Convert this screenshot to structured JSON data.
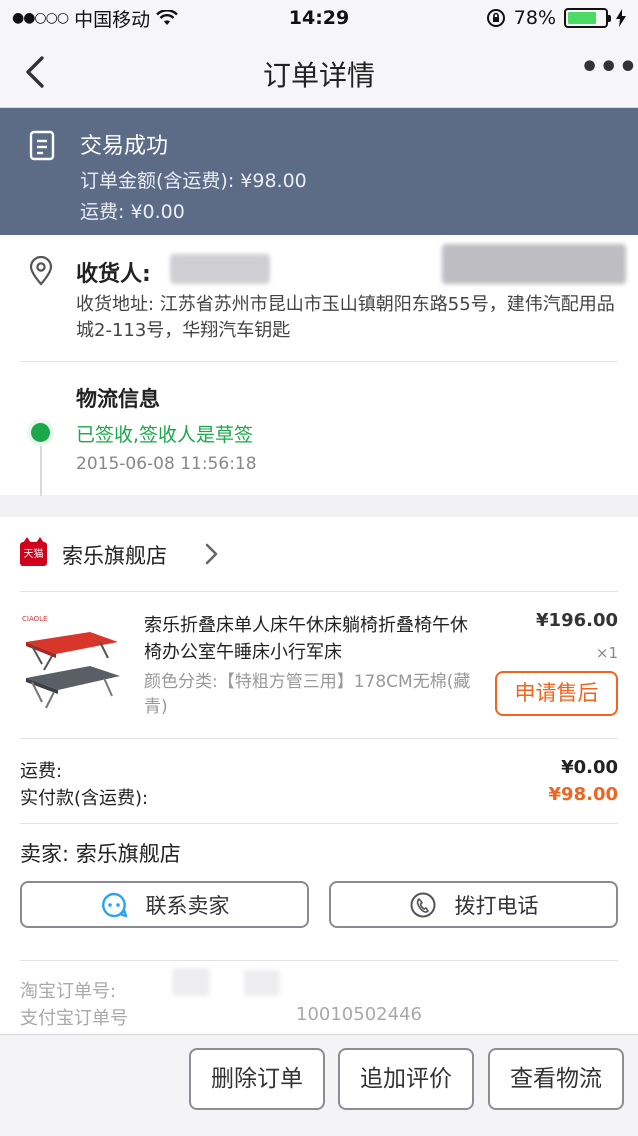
{
  "status_bar": {
    "carrier": "中国移动",
    "time": "14:29",
    "battery_text": "78%",
    "battery_level": 0.78
  },
  "nav": {
    "title": "订单详情",
    "more": "•••"
  },
  "order_status": {
    "title": "交易成功",
    "amount_line": "订单金额(含运费): ¥98.00",
    "shipping_line": "运费: ¥0.00"
  },
  "receiver": {
    "label": "收货人:",
    "address": "收货地址: 江苏省苏州市昆山市玉山镇朝阳东路55号，建伟汽配用品城2-113号，华翔汽车钥匙"
  },
  "logistics": {
    "title": "物流信息",
    "status": "已签收,签收人是草签",
    "time": "2015-06-08 11:56:18"
  },
  "shop": {
    "badge": "天猫",
    "name": "索乐旗舰店"
  },
  "product": {
    "title": "索乐折叠床单人床午休床躺椅折叠椅午休椅办公室午睡床小行军床",
    "spec": "颜色分类:【特粗方管三用】178CM无棉(藏青)",
    "price": "¥196.00",
    "qty": "×1",
    "after_sale_label": "申请售后"
  },
  "fees": {
    "shipping_label": "运费:",
    "shipping_value": "¥0.00",
    "paid_label": "实付款(含运费):",
    "paid_value": "¥98.00"
  },
  "seller": {
    "text": "卖家: 索乐旗舰店",
    "contact_label": "联系卖家",
    "call_label": "拨打电话"
  },
  "order_meta": {
    "taobao_label": "淘宝订单号:",
    "alipay_label": "支付宝订单号",
    "alipay_partial": "10010502446"
  },
  "actions": {
    "delete": "删除订单",
    "review": "追加评价",
    "logistics": "查看物流"
  },
  "colors": {
    "banner": "#5c6b86",
    "accent_orange": "#f2641e",
    "success_green": "#1aa84a",
    "tmall_red": "#d0021b"
  }
}
